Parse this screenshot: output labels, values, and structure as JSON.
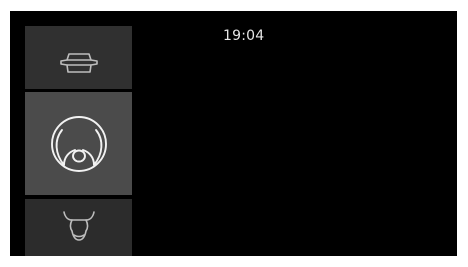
{
  "status_bar": {
    "time": "19:04"
  },
  "categories": [
    {
      "icon": "food-container-icon",
      "selected": false
    },
    {
      "icon": "poultry-icon",
      "selected": true
    },
    {
      "icon": "beef-icon",
      "selected": false
    }
  ],
  "colors": {
    "screen_background": "#000000",
    "tile_background": "#303030",
    "tile_selected_background": "#4b4b4b",
    "icon_color": "#bdbdbd",
    "icon_selected_color": "#f2f2f2",
    "clock_text": "#e6e6e6"
  }
}
